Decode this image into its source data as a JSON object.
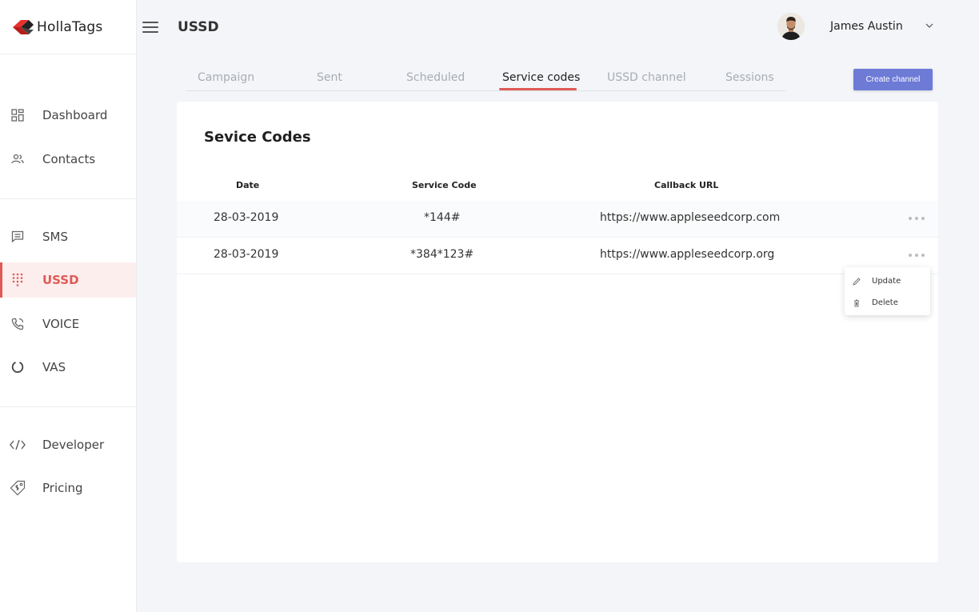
{
  "brand": {
    "name": "HollaTags"
  },
  "sidebar": {
    "items": [
      {
        "label": "Dashboard",
        "icon": "dashboard-icon"
      },
      {
        "label": "Contacts",
        "icon": "contacts-icon"
      },
      {
        "label": "SMS",
        "icon": "sms-icon"
      },
      {
        "label": "USSD",
        "icon": "ussd-keypad-icon",
        "active": true
      },
      {
        "label": "VOICE",
        "icon": "phone-icon"
      },
      {
        "label": "VAS",
        "icon": "vas-ring-icon"
      },
      {
        "label": "Developer",
        "icon": "code-icon"
      },
      {
        "label": "Pricing",
        "icon": "price-tag-icon"
      }
    ]
  },
  "header": {
    "title": "USSD",
    "user": {
      "name": "James Austin"
    }
  },
  "tabs": [
    {
      "label": "Campaign"
    },
    {
      "label": "Sent"
    },
    {
      "label": "Scheduled"
    },
    {
      "label": "Service codes",
      "active": true
    },
    {
      "label": "USSD channel"
    },
    {
      "label": "Sessions"
    }
  ],
  "actions": {
    "create_label": "Create channel"
  },
  "card": {
    "title": "Sevice Codes",
    "columns": {
      "date": "Date",
      "code": "Service Code",
      "url": "Callback URL"
    },
    "rows": [
      {
        "date": "28-03-2019",
        "code": "*144#",
        "url": "https://www.appleseedcorp.com"
      },
      {
        "date": "28-03-2019",
        "code": "*384*123#",
        "url": "https://www.appleseedcorp.org"
      }
    ]
  },
  "row_menu": {
    "update_label": "Update",
    "delete_label": "Delete"
  },
  "colors": {
    "accent": "#e05a55",
    "primary": "#6d7ad6",
    "background": "#f3f5f8"
  }
}
